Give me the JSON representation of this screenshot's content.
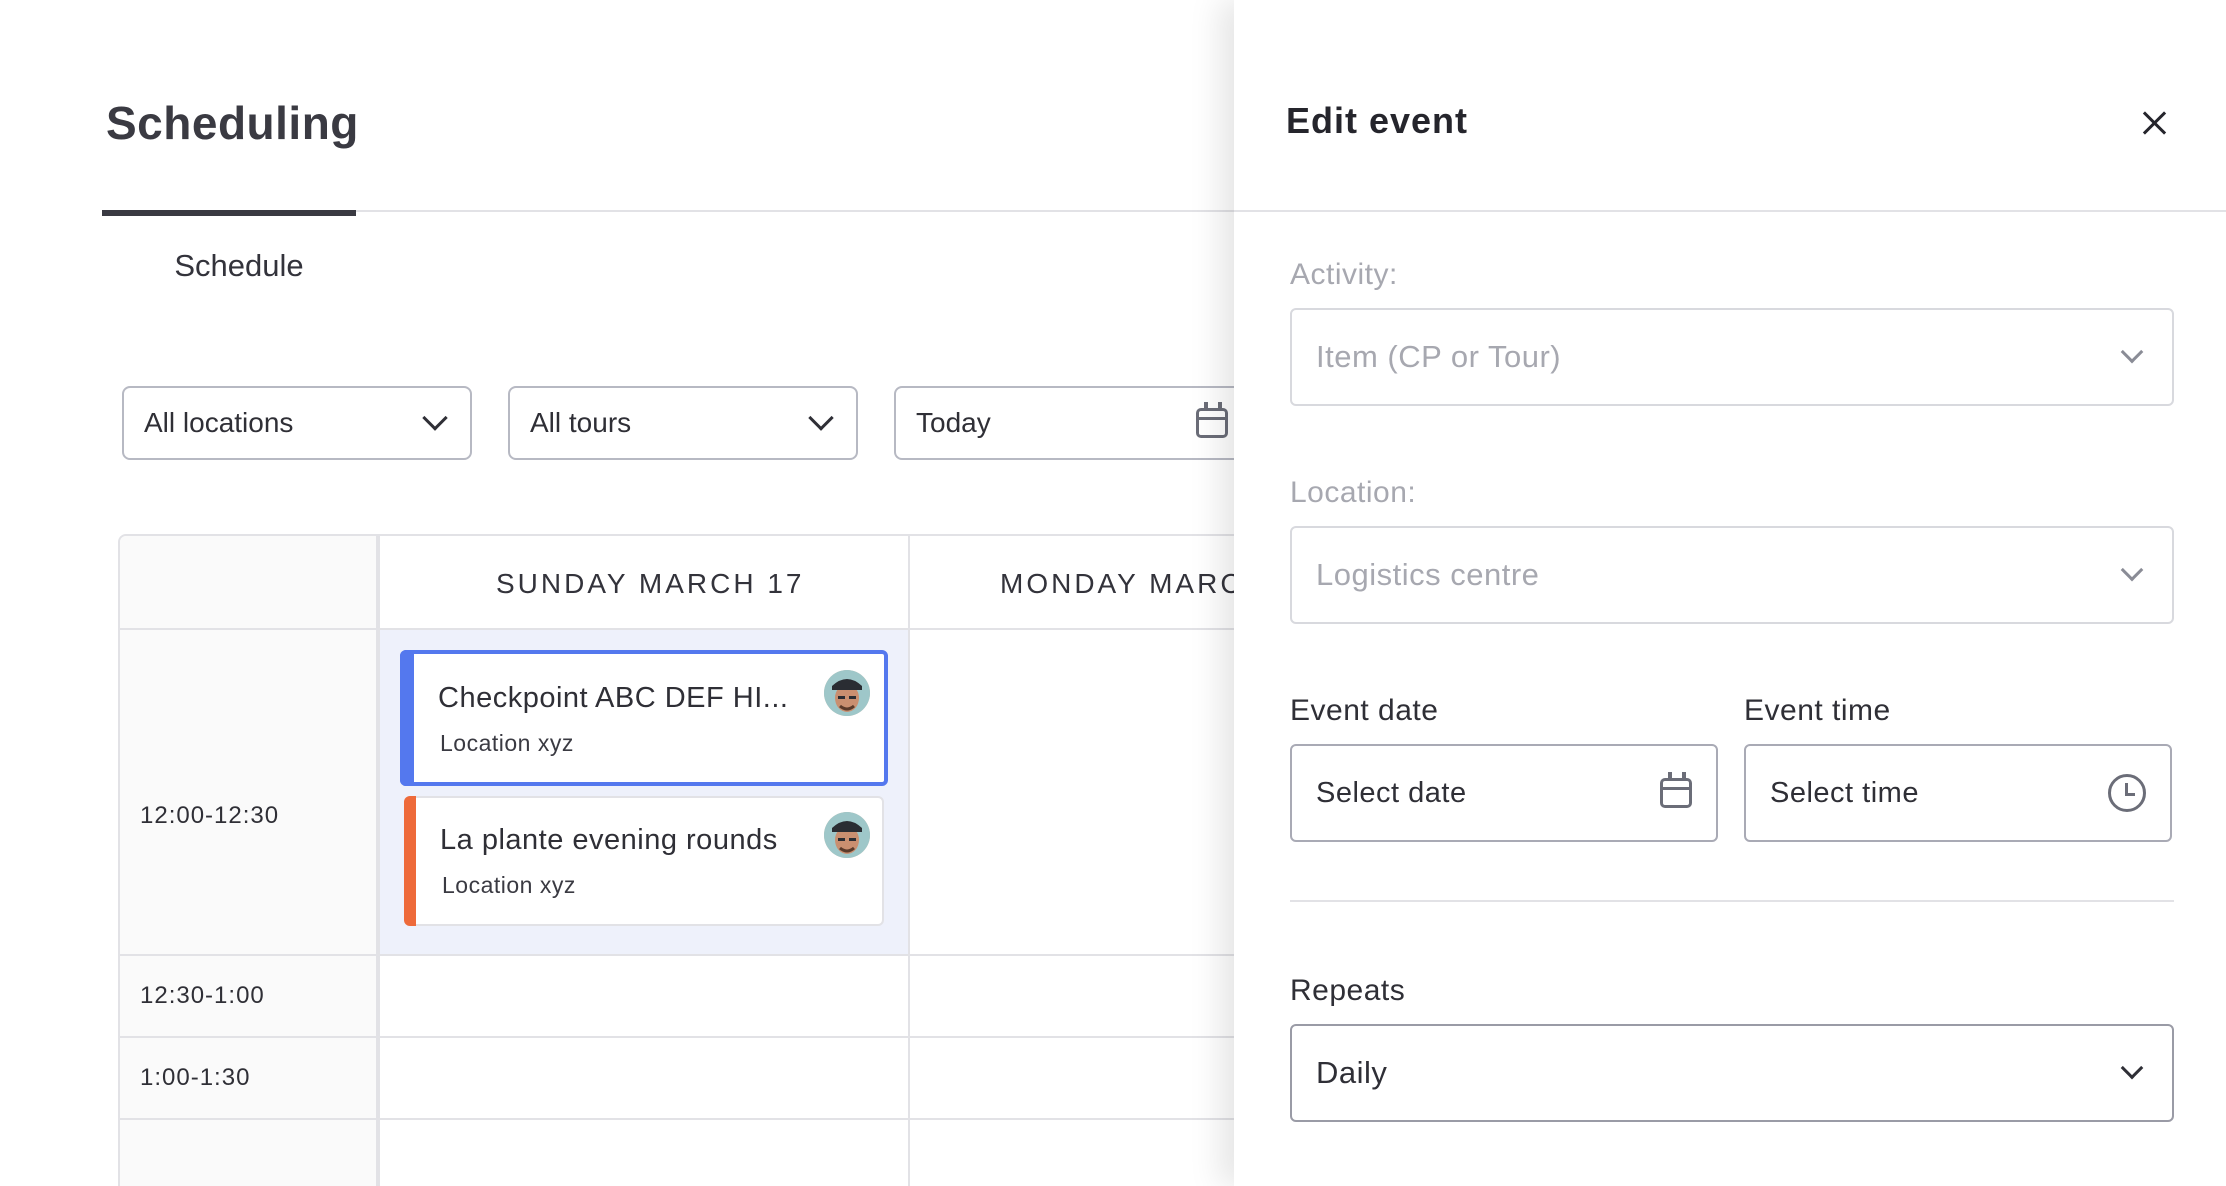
{
  "page": {
    "title": "Scheduling"
  },
  "tabs": [
    {
      "label": "Schedule",
      "active": true
    }
  ],
  "filters": {
    "location": {
      "value": "All locations"
    },
    "tours": {
      "value": "All tours"
    },
    "date": {
      "value": "Today"
    }
  },
  "calendar": {
    "days": [
      {
        "label": "SUNDAY MARCH 17"
      },
      {
        "label": "MONDAY MARC"
      }
    ],
    "time_slots": [
      "12:00-12:30",
      "12:30-1:00",
      "1:00-1:30"
    ],
    "events": [
      {
        "title": "Checkpoint ABC DEF HI...",
        "location": "Location xyz",
        "color": "#5478ee",
        "selected": true
      },
      {
        "title": "La plante evening rounds",
        "location": "Location xyz",
        "color": "#ee6a3a",
        "selected": false
      }
    ]
  },
  "drawer": {
    "title": "Edit event",
    "activity": {
      "label": "Activity:",
      "placeholder": "Item (CP or Tour)"
    },
    "location": {
      "label": "Location:",
      "value": "Logistics centre"
    },
    "event_date": {
      "label": "Event date",
      "placeholder": "Select date"
    },
    "event_time": {
      "label": "Event time",
      "placeholder": "Select time"
    },
    "repeats": {
      "label": "Repeats",
      "value": "Daily"
    }
  },
  "icons": {
    "chevron": "chevron-down-icon",
    "calendar": "calendar-icon",
    "clock": "clock-icon",
    "close": "close-icon"
  },
  "colors": {
    "accent_blue": "#5478ee",
    "accent_orange": "#ee6a3a",
    "highlight": "#eef1fb"
  }
}
